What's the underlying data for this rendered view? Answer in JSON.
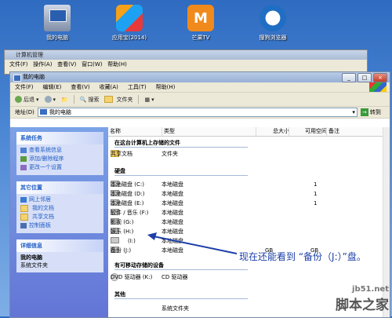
{
  "desktop": {
    "icons": [
      {
        "label": "我的电脑",
        "icon": "computer-icon"
      },
      {
        "label": "应用宝(2014)",
        "icon": "app-store-icon"
      },
      {
        "label": "芒果TV",
        "icon": "mango-tv-icon"
      },
      {
        "label": "搜狗浏览器",
        "icon": "sogou-browser-icon"
      }
    ]
  },
  "bg_window": {
    "title": "计算机管理",
    "menu": [
      "文件(F)",
      "操作(A)",
      "查看(V)",
      "窗口(W)",
      "帮助(H)"
    ]
  },
  "window": {
    "title": "我的电脑",
    "menu": [
      "文件(F)",
      "编辑(E)",
      "查看(V)",
      "收藏(A)",
      "工具(T)",
      "帮助(H)"
    ],
    "toolbar": {
      "back": "后退",
      "search": "搜索",
      "folders": "文件夹"
    },
    "address": {
      "label": "地址(D)",
      "value": "我的电脑",
      "go": "转到"
    }
  },
  "left_pane": {
    "system_tasks": {
      "title": "系统任务",
      "items": [
        "查看系统信息",
        "添加/删除程序",
        "更改一个设置"
      ]
    },
    "other_places": {
      "title": "其它位置",
      "items": [
        "网上邻居",
        "我的文档",
        "共享文档",
        "控制面板"
      ]
    },
    "details": {
      "title": "详细信息",
      "name": "我的电脑",
      "subtitle": "系统文件夹"
    }
  },
  "columns": [
    "名称",
    "类型",
    "总大小",
    "可用空间",
    "备注"
  ],
  "groups": {
    "stored": "在这台计算机上存储的文件",
    "hard_drives": "硬盘",
    "removable": "有可移动存储的设备",
    "other": "其他"
  },
  "stored_files": [
    {
      "name": "共享文档",
      "type": "文件夹"
    }
  ],
  "drives": [
    {
      "name": "本地磁盘 (C:)",
      "type": "本地磁盘",
      "size": "",
      "free": "1"
    },
    {
      "name": "本地磁盘 (D:)",
      "type": "本地磁盘",
      "size": "",
      "free": "1"
    },
    {
      "name": "本地磁盘 (E:)",
      "type": "本地磁盘",
      "size": "",
      "free": "1"
    },
    {
      "name": "软件 / 音乐 (F:)",
      "type": "本地磁盘",
      "size": "",
      "free": ""
    },
    {
      "name": "影视 (G:)",
      "type": "本地磁盘",
      "size": "",
      "free": ""
    },
    {
      "name": "娱乐 (H:)",
      "type": "本地磁盘",
      "size": "",
      "free": ""
    },
    {
      "name": "(I:)",
      "type": "本地磁盘",
      "size": "",
      "free": ""
    },
    {
      "name": "备份 (J:)",
      "type": "本地磁盘",
      "size": "GB",
      "free": "GB"
    }
  ],
  "removable": [
    {
      "name": "DVD 驱动器 (K:)",
      "type": "CD 驱动器"
    }
  ],
  "other": [
    {
      "name": "",
      "type": "系统文件夹"
    }
  ],
  "annotation": "现在还能看到 “备份（J:）”盘。",
  "watermark": {
    "line1": "jb51.net",
    "line2": "脚本之家"
  }
}
